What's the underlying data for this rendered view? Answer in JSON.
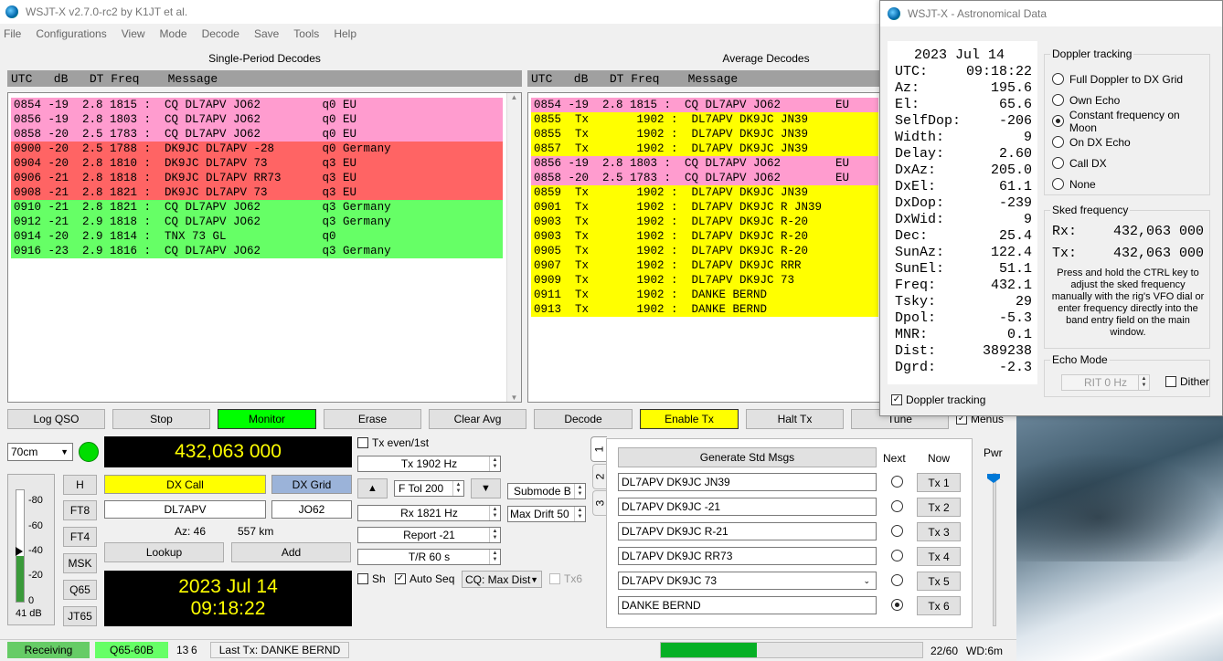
{
  "title": "WSJT-X   v2.7.0-rc2   by K1JT et al.",
  "menu": [
    "File",
    "Configurations",
    "View",
    "Mode",
    "Decode",
    "Save",
    "Tools",
    "Help"
  ],
  "left_title": "Single-Period Decodes",
  "right_title": "Average Decodes",
  "header_left": "UTC   dB   DT Freq    Message",
  "header_right": "UTC   dB   DT Freq    Message",
  "left_decodes": [
    {
      "text": "0854 -19  2.8 1815 :  CQ DL7APV JO62         q0 EU",
      "color": "pink"
    },
    {
      "text": "0856 -19  2.8 1803 :  CQ DL7APV JO62         q0 EU",
      "color": "pink"
    },
    {
      "text": "0858 -20  2.5 1783 :  CQ DL7APV JO62         q0 EU",
      "color": "pink"
    },
    {
      "text": "0900 -20  2.5 1788 :  DK9JC DL7APV -28       q0 Germany",
      "color": "red"
    },
    {
      "text": "0904 -20  2.8 1810 :  DK9JC DL7APV 73        q3 EU",
      "color": "red"
    },
    {
      "text": "0906 -21  2.8 1818 :  DK9JC DL7APV RR73      q3 EU",
      "color": "red"
    },
    {
      "text": "0908 -21  2.8 1821 :  DK9JC DL7APV 73        q3 EU",
      "color": "red"
    },
    {
      "text": "0910 -21  2.8 1821 :  CQ DL7APV JO62         q3 Germany",
      "color": "green"
    },
    {
      "text": "0912 -21  2.9 1818 :  CQ DL7APV JO62         q3 Germany",
      "color": "green"
    },
    {
      "text": "0914 -20  2.9 1814 :  TNX 73 GL              q0",
      "color": "green"
    },
    {
      "text": "0916 -23  2.9 1816 :  CQ DL7APV JO62         q3 Germany",
      "color": "green"
    }
  ],
  "right_decodes": [
    {
      "text": "0854 -19  2.8 1815 :  CQ DL7APV JO62        EU",
      "color": "pink"
    },
    {
      "text": "0855  Tx       1902 :  DL7APV DK9JC JN39",
      "color": "yellow"
    },
    {
      "text": "0855  Tx       1902 :  DL7APV DK9JC JN39",
      "color": "yellow"
    },
    {
      "text": "0857  Tx       1902 :  DL7APV DK9JC JN39",
      "color": "yellow"
    },
    {
      "text": "0856 -19  2.8 1803 :  CQ DL7APV JO62        EU",
      "color": "pink"
    },
    {
      "text": "0858 -20  2.5 1783 :  CQ DL7APV JO62        EU",
      "color": "pink"
    },
    {
      "text": "0859  Tx       1902 :  DL7APV DK9JC JN39",
      "color": "yellow"
    },
    {
      "text": "0901  Tx       1902 :  DL7APV DK9JC R JN39",
      "color": "yellow"
    },
    {
      "text": "0903  Tx       1902 :  DL7APV DK9JC R-20",
      "color": "yellow"
    },
    {
      "text": "0903  Tx       1902 :  DL7APV DK9JC R-20",
      "color": "yellow"
    },
    {
      "text": "0905  Tx       1902 :  DL7APV DK9JC R-20",
      "color": "yellow"
    },
    {
      "text": "0907  Tx       1902 :  DL7APV DK9JC RRR",
      "color": "yellow"
    },
    {
      "text": "0909  Tx       1902 :  DL7APV DK9JC 73",
      "color": "yellow"
    },
    {
      "text": "0911  Tx       1902 :  DANKE BERND",
      "color": "yellow"
    },
    {
      "text": "0913  Tx       1902 :  DANKE BERND",
      "color": "yellow"
    }
  ],
  "buttons": {
    "log_qso": "Log QSO",
    "stop": "Stop",
    "monitor": "Monitor",
    "erase": "Erase",
    "clear_avg": "Clear Avg",
    "decode": "Decode",
    "enable_tx": "Enable Tx",
    "halt_tx": "Halt Tx",
    "tune": "Tune",
    "menus": "Menus"
  },
  "band": "70cm",
  "frequency": "432,063 000",
  "level_ticks": [
    "-80",
    "-60",
    "-40",
    "-20",
    "0"
  ],
  "level_value": "41 dB",
  "level_fraction": 0.41,
  "modes": [
    "H",
    "FT8",
    "FT4",
    "MSK",
    "Q65",
    "JT65"
  ],
  "dx_call_label": "DX Call",
  "dx_grid_label": "DX Grid",
  "dx_call": "DL7APV",
  "dx_grid": "JO62",
  "az": "Az: 46",
  "dist": "557 km",
  "lookup": "Lookup",
  "add": "Add",
  "date": "2023 Jul 14",
  "time": "09:18:22",
  "tx_even": "Tx even/1st",
  "tx_freq": "Tx  1902  Hz",
  "ftol": "F Tol  200",
  "rx_freq": "Rx  1821  Hz",
  "report": "Report -21",
  "tr": "T/R  60  s",
  "submode": "Submode B",
  "max_drift": "Max Drift  50",
  "sh": "Sh",
  "auto_seq": "Auto Seq",
  "cq_max": "CQ: Max Dist",
  "tx6_chk": "Tx6",
  "tabs": [
    "1",
    "2",
    "3"
  ],
  "gen_std": "Generate Std Msgs",
  "next": "Next",
  "now": "Now",
  "tx_msgs": [
    {
      "text": "DL7APV DK9JC JN39",
      "btn": "Tx 1"
    },
    {
      "text": "DL7APV DK9JC -21",
      "btn": "Tx 2"
    },
    {
      "text": "DL7APV DK9JC R-21",
      "btn": "Tx 3"
    },
    {
      "text": "DL7APV DK9JC RR73",
      "btn": "Tx 4"
    },
    {
      "text": "DL7APV DK9JC 73",
      "btn": "Tx 5"
    },
    {
      "text": "DANKE BERND",
      "btn": "Tx 6"
    }
  ],
  "pwr": "Pwr",
  "status": {
    "receiving": "Receiving",
    "mode": "Q65-60B",
    "n1": "13",
    "n2": "6",
    "last_tx": "Last Tx: DANKE BERND",
    "progress": "22/60",
    "progress_fraction": 0.3667,
    "wd": "WD:6m"
  },
  "astro": {
    "title": "WSJT-X - Astronomical Data",
    "date": "2023 Jul 14",
    "rows": [
      {
        "k": "UTC:",
        "v": "09:18:22"
      },
      {
        "k": "Az:",
        "v": "195.6"
      },
      {
        "k": "El:",
        "v": "65.6"
      },
      {
        "k": "SelfDop:",
        "v": "-206"
      },
      {
        "k": "Width:",
        "v": "9"
      },
      {
        "k": "Delay:",
        "v": "2.60"
      },
      {
        "k": "DxAz:",
        "v": "205.0"
      },
      {
        "k": "DxEl:",
        "v": "61.1"
      },
      {
        "k": "DxDop:",
        "v": "-239"
      },
      {
        "k": "DxWid:",
        "v": "9"
      },
      {
        "k": "Dec:",
        "v": "25.4"
      },
      {
        "k": "SunAz:",
        "v": "122.4"
      },
      {
        "k": "SunEl:",
        "v": "51.1"
      },
      {
        "k": "Freq:",
        "v": "432.1"
      },
      {
        "k": "Tsky:",
        "v": "29"
      },
      {
        "k": "Dpol:",
        "v": "-5.3"
      },
      {
        "k": "MNR:",
        "v": "0.1"
      },
      {
        "k": "Dist:",
        "v": "389238"
      },
      {
        "k": "Dgrd:",
        "v": "-2.3"
      }
    ],
    "doppler_title": "Doppler tracking",
    "doppler_opts": [
      {
        "label": "Full Doppler to DX Grid",
        "on": false
      },
      {
        "label": "Own Echo",
        "on": false
      },
      {
        "label": "Constant frequency on Moon",
        "on": true
      },
      {
        "label": "On DX Echo",
        "on": false
      },
      {
        "label": "Call DX",
        "on": false
      },
      {
        "label": "None",
        "on": false
      }
    ],
    "sked_title": "Sked frequency",
    "sked_rx_label": "Rx:",
    "sked_rx": "432,063 000",
    "sked_tx_label": "Tx:",
    "sked_tx": "432,063 000",
    "sked_note": "Press and hold the CTRL key to adjust the sked frequency manually with the rig's VFO dial or enter frequency directly into the band entry field on the main window.",
    "echo_title": "Echo Mode",
    "rit": "RIT  0  Hz",
    "dither": "Dither",
    "doppler_chk": "Doppler tracking"
  }
}
